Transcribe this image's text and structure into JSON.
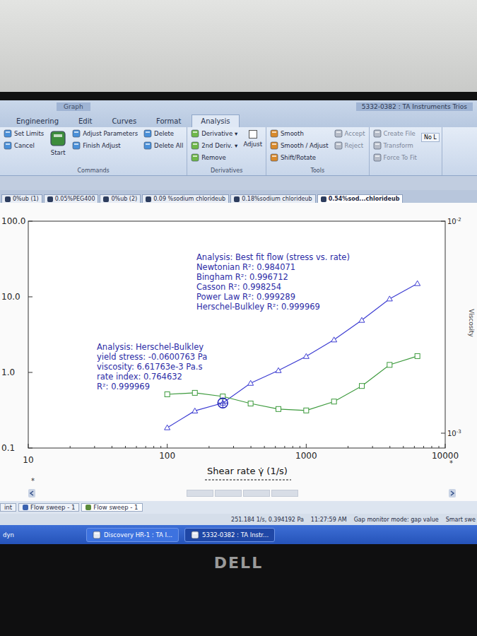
{
  "window": {
    "title": "5332-0382 : TA Instruments Trios"
  },
  "ribbon": {
    "context_label": "Graph",
    "tabs": [
      {
        "label": "Engineering",
        "selected": false
      },
      {
        "label": "Edit",
        "selected": false
      },
      {
        "label": "Curves",
        "selected": false
      },
      {
        "label": "Format",
        "selected": false
      },
      {
        "label": "Analysis",
        "selected": true
      }
    ],
    "groups": [
      {
        "label": "Commands",
        "columns": [
          [
            {
              "label": "Set Limits",
              "kind": "small",
              "disabled": false
            },
            {
              "label": "Cancel",
              "kind": "small",
              "disabled": false
            }
          ],
          [
            {
              "label": "Start",
              "kind": "large",
              "disabled": false
            }
          ],
          [
            {
              "label": "Adjust Parameters",
              "kind": "small",
              "disabled": false
            },
            {
              "label": "Finish Adjust",
              "kind": "small",
              "disabled": false
            }
          ],
          [
            {
              "label": "Delete",
              "kind": "small",
              "disabled": false
            },
            {
              "label": "Delete All",
              "kind": "small",
              "disabled": false
            }
          ]
        ]
      },
      {
        "label": "Derivatives",
        "columns": [
          [
            {
              "label": "Derivative",
              "menu": "▾",
              "kind": "small",
              "disabled": false
            },
            {
              "label": "2nd Deriv.",
              "menu": "▾",
              "kind": "small",
              "disabled": false
            },
            {
              "label": "Remove",
              "kind": "small",
              "disabled": false
            }
          ],
          [
            {
              "label": "Adjust",
              "kind": "check",
              "checked": false,
              "disabled": false
            }
          ]
        ]
      },
      {
        "label": "Tools",
        "columns": [
          [
            {
              "label": "Smooth",
              "kind": "small",
              "disabled": false
            },
            {
              "label": "Smooth / Adjust",
              "kind": "small",
              "disabled": false
            },
            {
              "label": "Shift/Rotate",
              "kind": "small",
              "disabled": false
            }
          ],
          [
            {
              "label": "Accept",
              "kind": "small",
              "disabled": true
            },
            {
              "label": "Reject",
              "kind": "small",
              "disabled": true
            }
          ]
        ]
      },
      {
        "label": "",
        "columns": [
          [
            {
              "label": "Create File",
              "kind": "small",
              "disabled": true
            },
            {
              "label": "Transform",
              "kind": "small",
              "disabled": true
            },
            {
              "label": "Force To Fit",
              "kind": "small",
              "disabled": true
            }
          ],
          [
            {
              "label": "No L",
              "kind": "field",
              "disabled": false
            }
          ]
        ]
      }
    ]
  },
  "document_tabs": [
    {
      "label": "0%ub (1)",
      "selected": false
    },
    {
      "label": "0.05%PEG400",
      "selected": false
    },
    {
      "label": "0%ub (2)",
      "selected": false
    },
    {
      "label": "0.09 %sodium chlorideub",
      "selected": false
    },
    {
      "label": "0.18%sodium chlorideub",
      "selected": false
    },
    {
      "label": "0.54%sod...chlorideub",
      "selected": true
    }
  ],
  "chart": {
    "x_axis": {
      "label": "Shear rate γ̇ (1/s)",
      "ticks": [
        {
          "value": 10,
          "label": "10"
        },
        {
          "value": 100,
          "label": "100"
        },
        {
          "value": 1000,
          "label": "1000"
        },
        {
          "value": 10000,
          "label": "10000"
        }
      ]
    },
    "left_axis": {
      "ticks": [
        {
          "value": 100,
          "label": "100.0"
        },
        {
          "value": 10,
          "label": "10.0"
        },
        {
          "value": 1,
          "label": "1.0"
        },
        {
          "value": 0.1,
          "label": "0.1"
        }
      ]
    },
    "right_axis": {
      "label": "Viscosity",
      "ticks": [
        {
          "value": 0.01,
          "base": "10",
          "exp": "-2"
        },
        {
          "value": 0.001,
          "base": "10",
          "exp": "-3"
        }
      ]
    },
    "shear_rates": [
      100,
      158,
      251,
      398,
      631,
      1000,
      1585,
      2512,
      3981,
      6310
    ],
    "series": [
      {
        "name": "Stress",
        "axis": "left",
        "marker": "triangle",
        "color": "#3c3cd2",
        "values": [
          0.186,
          0.31,
          0.394,
          0.72,
          1.06,
          1.63,
          2.7,
          4.9,
          9.4,
          15.0
        ]
      },
      {
        "name": "Viscosity",
        "axis": "right",
        "marker": "square",
        "color": "#3c9a3c",
        "values": [
          0.001525,
          0.00155,
          0.00149,
          0.00138,
          0.0013,
          0.00128,
          0.00141,
          0.00167,
          0.0021,
          0.00231
        ]
      }
    ],
    "cursor": {
      "series": 0,
      "index": 2
    },
    "annotations": [
      {
        "lines": [
          "Analysis: Best fit flow (stress vs. rate)",
          "Newtonian R²: 0.984071",
          "Bingham R²: 0.996712",
          "Casson R²: 0.998254",
          "Power Law R²: 0.999289",
          "Herschel-Bulkley R²: 0.999969"
        ]
      },
      {
        "lines": [
          "Analysis: Herschel-Bulkley",
          "yield stress: -0.0600763 Pa",
          "viscosity: 6.61763e-3 Pa.s",
          "rate index: 0.764632",
          "R²: 0.999969"
        ]
      }
    ],
    "marks": [
      "*",
      "*"
    ]
  },
  "bottom_tabs": [
    {
      "label": "int",
      "selected": false
    },
    {
      "label": "Flow sweep - 1",
      "selected": false
    },
    {
      "label": "Flow sweep - 1",
      "selected": true
    }
  ],
  "status_bar": [
    "251.184 1/s, 0.394192 Pa",
    "11:27:59 AM",
    "Gap monitor mode: gap value",
    "Smart swe"
  ],
  "taskbar": {
    "start": "dyn",
    "buttons": [
      {
        "label": "Discovery HR-1 : TA I...",
        "selected": false
      },
      {
        "label": "5332-0382 : TA Instr...",
        "selected": true
      }
    ]
  },
  "monitor": {
    "brand": "DELL"
  }
}
